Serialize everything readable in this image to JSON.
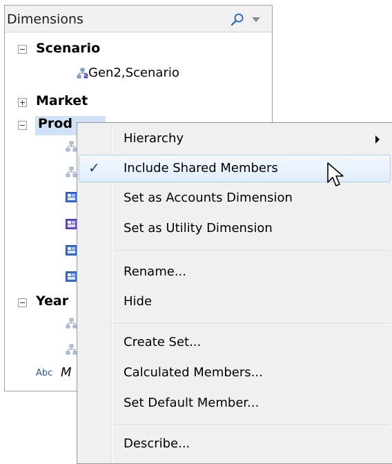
{
  "panel": {
    "title": "Dimensions",
    "tree": {
      "scenario": {
        "label": "Scenario",
        "children": [
          "Gen2,Scenario"
        ]
      },
      "market": {
        "label": "Market"
      },
      "product": {
        "label": "Prod"
      },
      "year": {
        "label": "Year"
      },
      "measures": {
        "abc": "Abc",
        "label": "M"
      }
    }
  },
  "context_menu": {
    "items": [
      {
        "label": "Hierarchy",
        "has_submenu": true
      },
      {
        "label": "Include Shared Members",
        "checked": true,
        "hovered": true
      },
      {
        "label": "Set as Accounts Dimension"
      },
      {
        "label": "Set as Utility Dimension"
      },
      {
        "label": "Rename..."
      },
      {
        "label": "Hide"
      },
      {
        "label": "Create Set..."
      },
      {
        "label": "Calculated Members..."
      },
      {
        "label": "Set Default Member..."
      },
      {
        "label": "Describe..."
      }
    ],
    "check_glyph": "✓"
  },
  "colors": {
    "selection": "#cfe2f7",
    "menu_background": "#f0f0f0",
    "hover_border": "#aeccee",
    "icon_blue": "#2b4f9a"
  }
}
